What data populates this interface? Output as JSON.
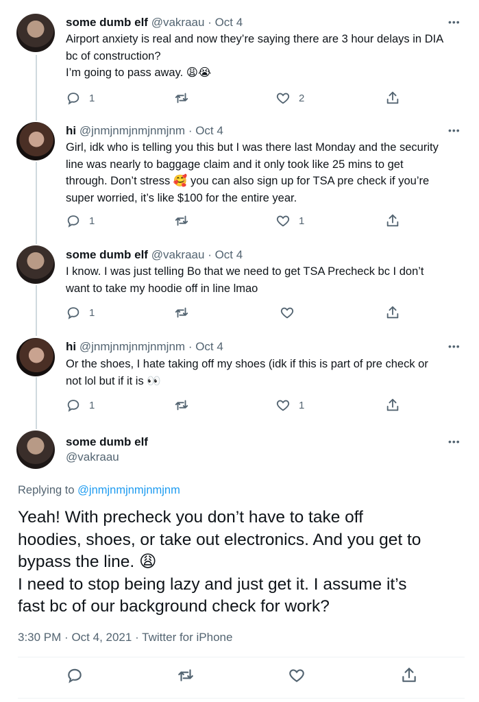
{
  "tweets": [
    {
      "name": "some dumb elf",
      "handle": "@vakraau",
      "date": "· Oct 4",
      "lines": [
        "Airport anxiety is real and now they’re saying there are 3 hour delays in DIA",
        "bc of construction?",
        "I’m going to pass away. 😩😭"
      ],
      "replies": "1",
      "retweets": "",
      "likes": "2"
    },
    {
      "name": "hi",
      "handle": "@jnmjnmjnmjnmjnm",
      "date": "· Oct 4",
      "lines": [
        "Girl, idk who is telling you this but I was there last Monday and the security",
        "line was nearly to baggage claim and it only took like 25 mins to get",
        "through. Don’t stress 🥰 you can also sign up for TSA pre check if you’re",
        "super worried, it’s like $100 for the entire year."
      ],
      "replies": "1",
      "retweets": "",
      "likes": "1"
    },
    {
      "name": "some dumb elf",
      "handle": "@vakraau",
      "date": "· Oct 4",
      "lines": [
        "I know. I was just telling Bo that we need to get TSA Precheck bc I don’t",
        "want to take my hoodie off in line lmao"
      ],
      "replies": "1",
      "retweets": "",
      "likes": ""
    },
    {
      "name": "hi",
      "handle": "@jnmjnmjnmjnmjnm",
      "date": "· Oct 4",
      "lines": [
        "Or the shoes, I hate taking off my shoes (idk if this is part of pre check or",
        "not lol but if it is 👀"
      ],
      "replies": "1",
      "retweets": "",
      "likes": "1"
    }
  ],
  "main_tweet": {
    "name": "some dumb elf",
    "handle": "@vakraau",
    "replying_label": "Replying to",
    "replying_handle": "@jnmjnmjnmjnmjnm",
    "lines": [
      "Yeah! With precheck you don’t have to take off",
      "hoodies, shoes, or take out electronics. And you get to",
      "bypass the line. 😩",
      "I need to stop being lazy and just get it. I assume it’s",
      "fast bc of our background check for work?"
    ],
    "time": "3:30 PM",
    "date": "Oct 4, 2021",
    "source": "Twitter for iPhone"
  },
  "more_label": "•••",
  "icons": {
    "reply": "reply-icon",
    "retweet": "retweet-icon",
    "like": "heart-icon",
    "share": "share-icon"
  },
  "colors": {
    "text": "#0f1419",
    "secondary": "#536471",
    "link": "#1d9bf0",
    "border": "#eff3f4"
  }
}
